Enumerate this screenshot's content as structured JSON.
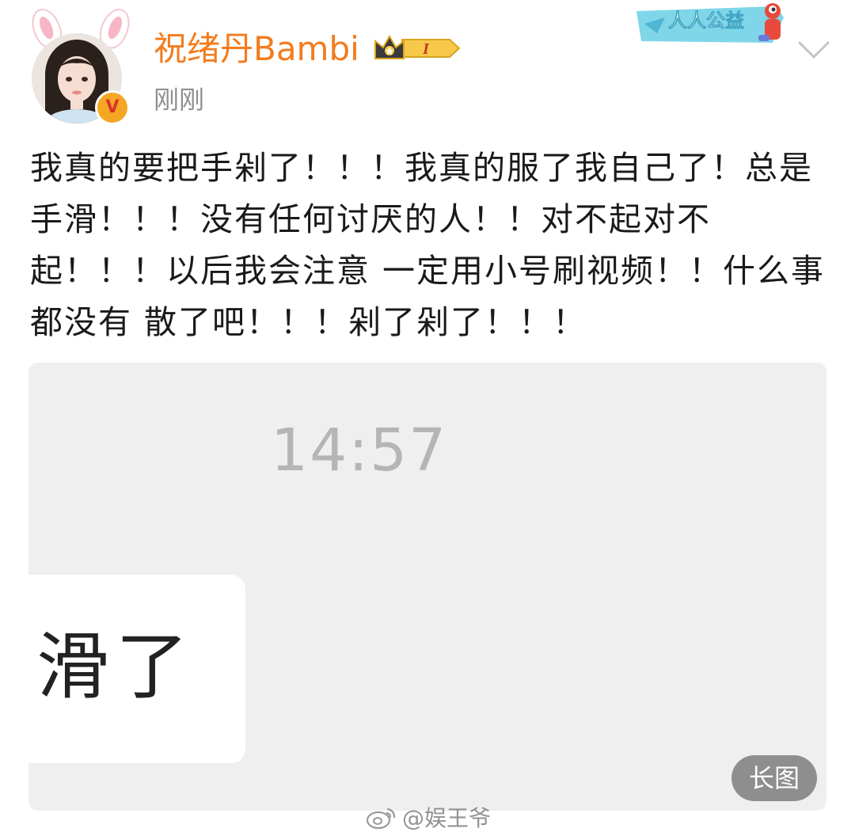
{
  "post": {
    "author_name": "祝绪丹Bambi",
    "timestamp": "刚刚",
    "level_badge": "I",
    "charity_banner_text": "人人公益",
    "text": "我真的要把手剁了！！！我真的服了我自己了！总是手滑！！！没有任何讨厌的人！！对不起对不起！！！以后我会注意 一定用小号刷视频！！什么事都没有 散了吧！！！剁了剁了！！！"
  },
  "image": {
    "clock_time": "14:57",
    "chat_bubble_text": "滑了",
    "long_image_label": "长图"
  },
  "watermark": {
    "text": "@娱王爷"
  },
  "colors": {
    "author_name": "#f37b1d",
    "timestamp": "#8f8f8f",
    "verified_badge": "#f5a623",
    "card_background": "#efefef"
  },
  "icons": {
    "verified": "verified-v-icon",
    "crown": "crown-icon",
    "chevron": "chevron-down-icon",
    "weibo": "weibo-logo-icon"
  }
}
